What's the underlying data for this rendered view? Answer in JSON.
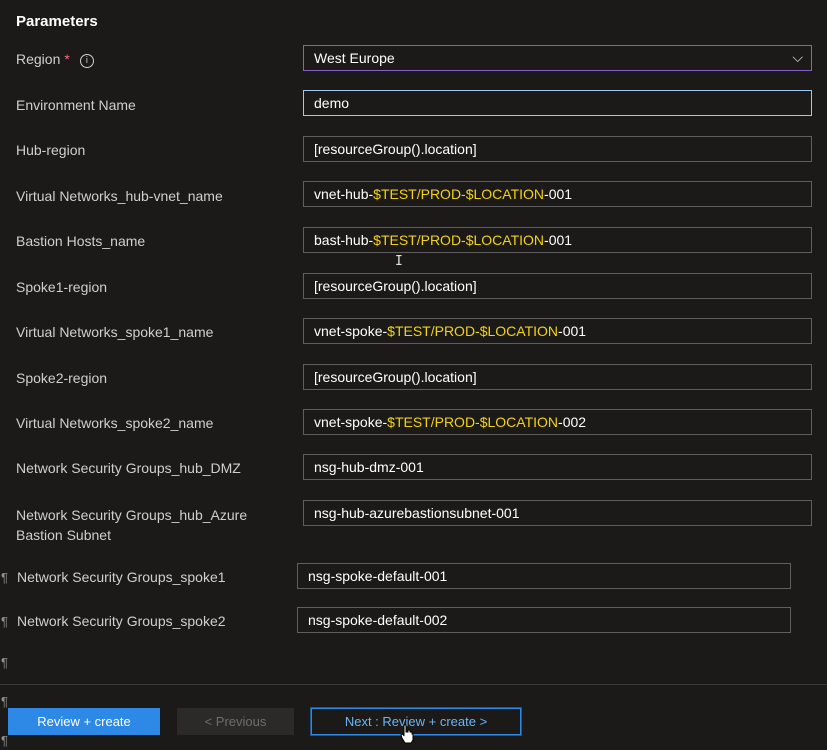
{
  "section_title": "Parameters",
  "fields": {
    "region": {
      "label": "Region",
      "required": "*",
      "value": "West Europe"
    },
    "environment_name": {
      "label": "Environment Name",
      "value": "demo"
    },
    "hub_region": {
      "label": "Hub-region",
      "value": "[resourceGroup().location]"
    },
    "hub_vnet_name": {
      "label": "Virtual Networks_hub-vnet_name",
      "prefix": "vnet-hub-",
      "highlight": "$TEST/PROD-$LOCATION",
      "suffix": "-001"
    },
    "bastion_hosts_name": {
      "label": "Bastion Hosts_name",
      "prefix": "bast-hub-",
      "highlight": "$TEST/PROD-$LOCATION",
      "suffix": "-001"
    },
    "spoke1_region": {
      "label": "Spoke1-region",
      "value": "[resourceGroup().location]"
    },
    "spoke1_vnet_name": {
      "label": "Virtual Networks_spoke1_name",
      "prefix": "vnet-spoke-",
      "highlight": "$TEST/PROD-$LOCATION",
      "suffix": "-001"
    },
    "spoke2_region": {
      "label": "Spoke2-region",
      "value": "[resourceGroup().location]"
    },
    "spoke2_vnet_name": {
      "label": "Virtual Networks_spoke2_name",
      "prefix": "vnet-spoke-",
      "highlight": "$TEST/PROD-$LOCATION",
      "suffix": "-002"
    },
    "nsg_hub_dmz": {
      "label": "Network Security Groups_hub_DMZ",
      "value": "nsg-hub-dmz-001"
    },
    "nsg_hub_bastion": {
      "label_line1": "Network Security Groups_hub_Azure",
      "label_line2": "Bastion Subnet",
      "value": "nsg-hub-azurebastionsubnet-001"
    },
    "nsg_spoke1": {
      "label": "Network Security Groups_spoke1",
      "value": "nsg-spoke-default-001"
    },
    "nsg_spoke2": {
      "label": "Network Security Groups_spoke2",
      "value": "nsg-spoke-default-002"
    }
  },
  "pilcrow": "¶",
  "buttons": {
    "review_create": "Review + create",
    "previous": "< Previous",
    "next": "Next : Review + create >"
  },
  "icons": {
    "info": "info-icon",
    "chevron": "chevron-down-icon",
    "cursor": "pointer-hand-cursor",
    "text_cursor": "i-beam-cursor"
  },
  "colors": {
    "background": "#1b1a19",
    "primary_button": "#2d89e5",
    "highlight_text": "#f2d311",
    "required_star": "#f1707b",
    "focus_border": "#9cc8f0",
    "select_border": "#8a5fc8"
  }
}
